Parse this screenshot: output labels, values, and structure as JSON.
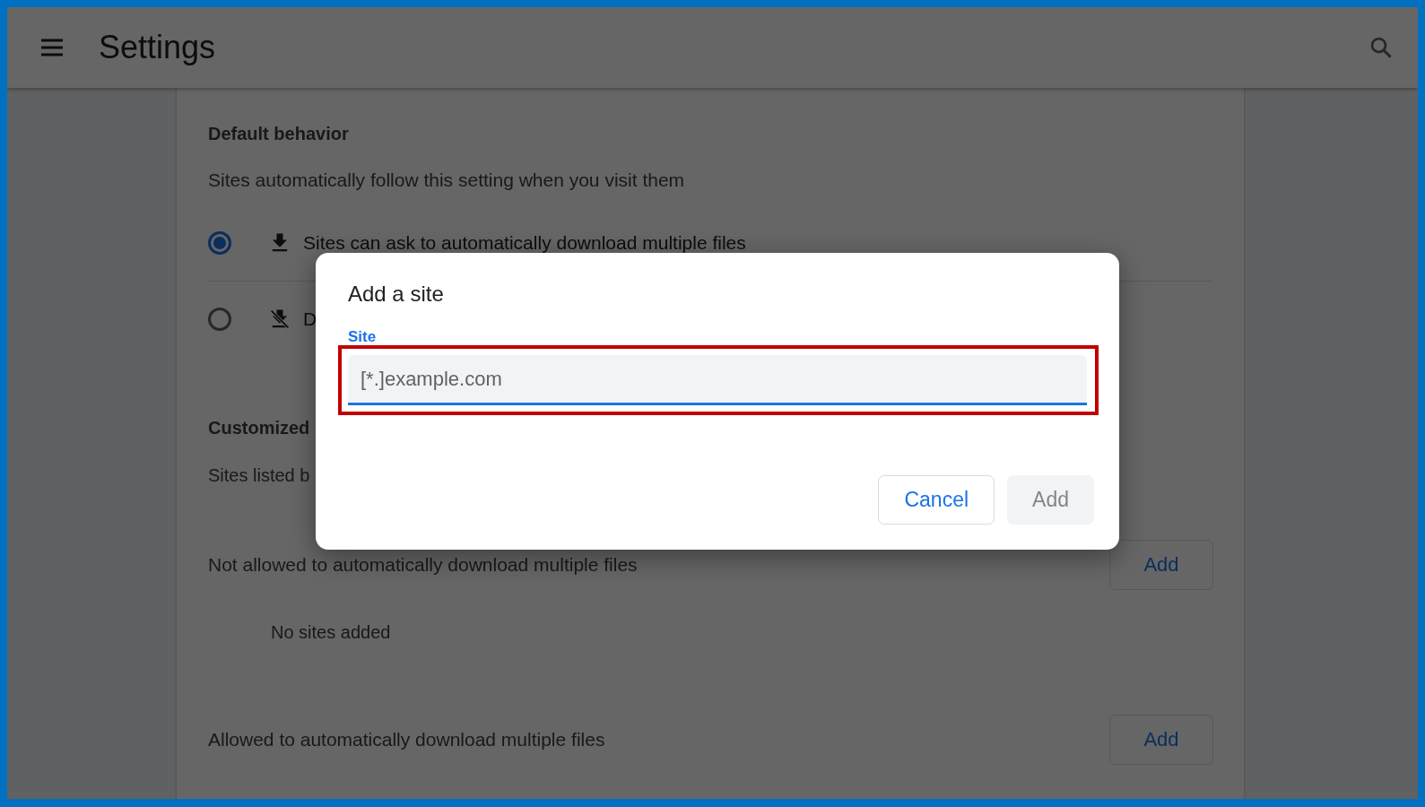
{
  "header": {
    "title": "Settings"
  },
  "default_behavior": {
    "heading": "Default behavior",
    "description": "Sites automatically follow this setting when you visit them",
    "options": [
      {
        "label": "Sites can ask to automatically download multiple files",
        "kind": "allow",
        "selected": true
      },
      {
        "label": "D",
        "kind": "block",
        "selected": false
      }
    ]
  },
  "customized": {
    "heading": "Customized",
    "description": "Sites listed b",
    "lists": [
      {
        "title": "Not allowed to automatically download multiple files",
        "button": "Add",
        "empty_text": "No sites added"
      },
      {
        "title": "Allowed to automatically download multiple files",
        "button": "Add"
      }
    ]
  },
  "dialog": {
    "title": "Add a site",
    "field": {
      "label": "Site",
      "placeholder": "[*.]example.com",
      "focused": true,
      "highlighted": true
    },
    "buttons": [
      {
        "label": "Cancel",
        "kind": "secondary",
        "disabled": false
      },
      {
        "label": "Add",
        "kind": "primary",
        "disabled": true
      }
    ]
  }
}
